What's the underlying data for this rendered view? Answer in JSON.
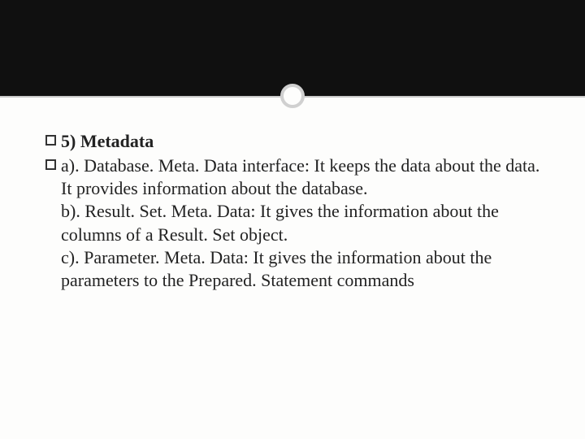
{
  "slide": {
    "heading_bullet": "",
    "heading_text": "5) Metadata",
    "body_bullet": "",
    "body_lines": [
      "a). Database. Meta. Data interface: It keeps the data about the data. It provides information about the database.",
      "b). Result. Set. Meta. Data: It gives the information about the columns of a Result. Set object.",
      "c). Parameter. Meta. Data: It gives the information about the parameters to the Prepared. Statement commands"
    ]
  }
}
